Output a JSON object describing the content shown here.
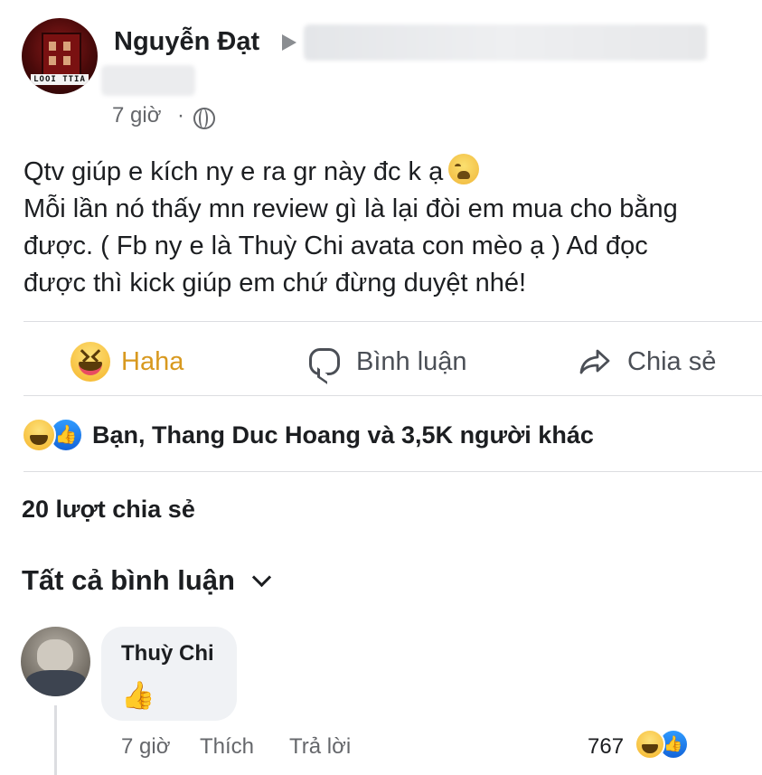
{
  "post": {
    "author": "Nguyễn Đạt",
    "time": "7 giờ",
    "separator": "·",
    "avatar_caption": "LOOI TTIA",
    "lines": [
      "Qtv giúp e kích ny e ra gr này đc k ạ",
      "Mỗi lần nó thấy mn review gì là lại đòi em mua cho bằng",
      "được. ( Fb ny e là Thuỳ Chi avata con mèo ạ ) Ad đọc",
      "được thì kick giúp em chứ đừng duyệt nhé!"
    ],
    "icons": {
      "privacy": "globe-icon",
      "emoji": "crying-face-icon"
    }
  },
  "actions": {
    "haha": "Haha",
    "comment": "Bình luận",
    "share": "Chia sẻ"
  },
  "reactions": {
    "summary": "Bạn, Thang Duc Hoang và 3,5K người khác",
    "icons": [
      "haha-icon",
      "like-icon"
    ]
  },
  "shares": "20 lượt chia sẻ",
  "comments_header": "Tất cả bình luận",
  "comment": {
    "name": "Thuỳ Chi",
    "content": "👍",
    "time": "7 giờ",
    "like": "Thích",
    "reply": "Trả lời",
    "reaction_count": "767"
  },
  "colors": {
    "haha_accent": "#d8991f",
    "text": "#1c1e21",
    "muted": "#65676b",
    "like_blue": "#1877f2"
  }
}
